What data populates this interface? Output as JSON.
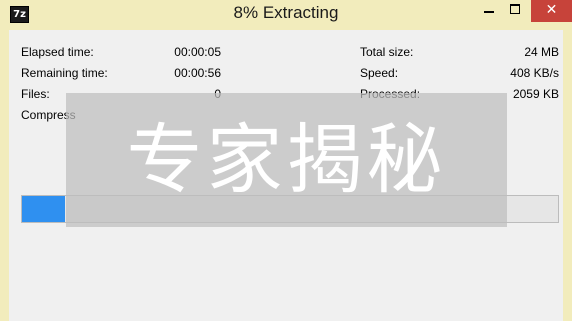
{
  "window": {
    "app_icon_text": "7z",
    "title": "8% Extracting",
    "controls": {
      "minimize": "",
      "maximize": "",
      "close": "✕"
    }
  },
  "stats": {
    "elapsed_label": "Elapsed time:",
    "elapsed_value": "00:00:05",
    "remaining_label": "Remaining time:",
    "remaining_value": "00:00:56",
    "files_label": "Files:",
    "files_value": "0",
    "compression_label": "Compress",
    "total_size_label": "Total size:",
    "total_size_value": "24 MB",
    "speed_label": "Speed:",
    "speed_value": "408 KB/s",
    "processed_label": "Processed:",
    "processed_value": "2059 KB"
  },
  "progress": {
    "percent": 8
  },
  "overlay": {
    "text": "专家揭秘"
  },
  "colors": {
    "accent": "#2f90f0",
    "close": "#c7433a",
    "frame": "#f2ecbc"
  }
}
